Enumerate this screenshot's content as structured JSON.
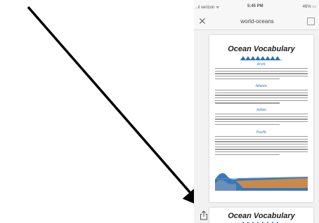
{
  "status_bar": {
    "signal": "..ıl verizon ᯤ",
    "time": "5:45 PM",
    "battery": "46% ▭"
  },
  "nav": {
    "close_icon": "close-icon",
    "title": "world-oceans",
    "markup_icon": "markup-icon"
  },
  "document": {
    "title": "Ocean Vocabulary",
    "sections": [
      {
        "heading": "Arctic"
      },
      {
        "heading": "Atlantic"
      },
      {
        "heading": "Indian"
      },
      {
        "heading": "Pacific"
      }
    ],
    "next_page_title": "Ocean Vocabulary"
  },
  "toolbar": {
    "share_icon": "share-icon"
  },
  "colors": {
    "section_heading": "#3a7bbf",
    "triangles": "#2e6fae",
    "arrow": "#000000",
    "sand": "#c98a4b",
    "water": "#3b78b8"
  }
}
